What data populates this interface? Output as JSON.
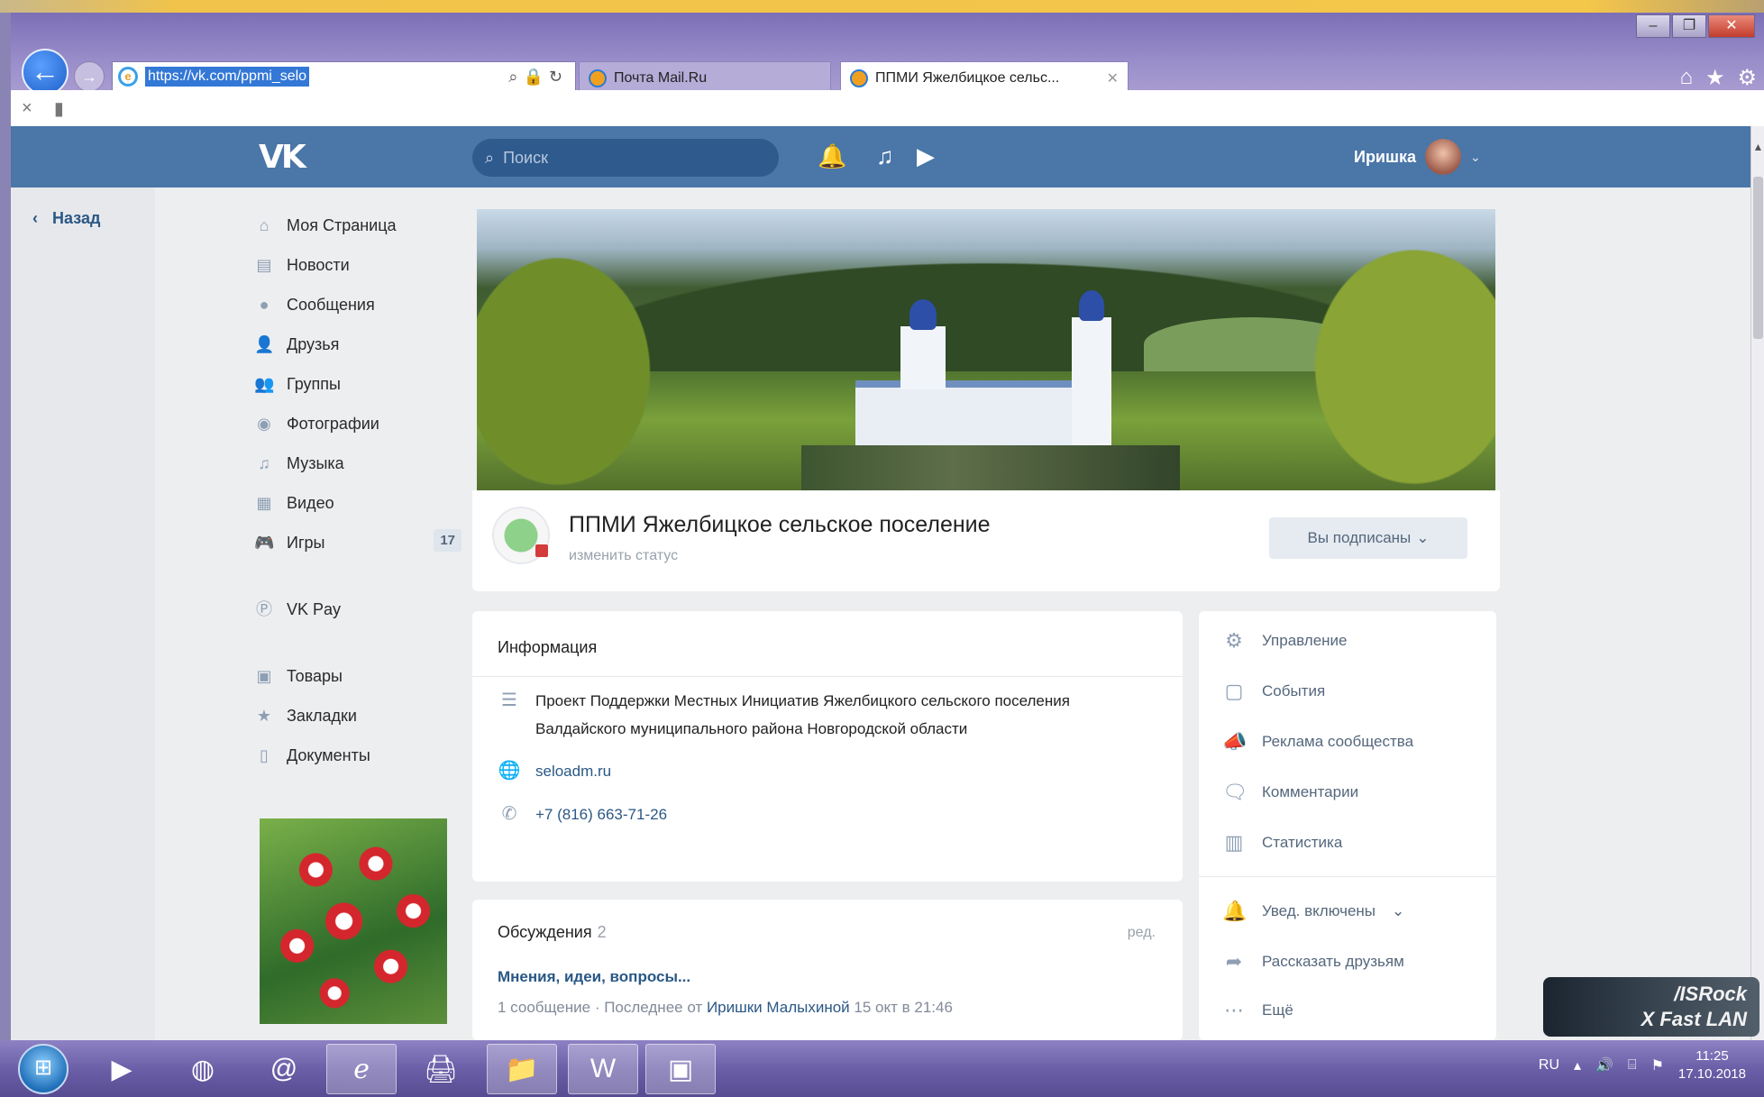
{
  "browser": {
    "url": "https://vk.com/ppmi_selo",
    "tabs": [
      {
        "label": "Почта Mail.Ru"
      },
      {
        "label": "ППМИ Яжелбицкое сельс..."
      }
    ]
  },
  "vk": {
    "logo": "VK",
    "search_placeholder": "Поиск",
    "user_name": "Иришка"
  },
  "back": {
    "label": "Назад"
  },
  "menu": {
    "items": [
      {
        "label": "Моя Страница",
        "icon": "home-icon"
      },
      {
        "label": "Новости",
        "icon": "news-icon"
      },
      {
        "label": "Сообщения",
        "icon": "messages-icon"
      },
      {
        "label": "Друзья",
        "icon": "friend-icon"
      },
      {
        "label": "Группы",
        "icon": "groups-icon"
      },
      {
        "label": "Фотографии",
        "icon": "camera-icon"
      },
      {
        "label": "Музыка",
        "icon": "music-icon"
      },
      {
        "label": "Видео",
        "icon": "video-icon"
      },
      {
        "label": "Игры",
        "icon": "gamepad-icon",
        "count": "17"
      }
    ],
    "items2": [
      {
        "label": "VK Pay",
        "icon": "vkpay-icon"
      }
    ],
    "items3": [
      {
        "label": "Товары",
        "icon": "bag-icon"
      },
      {
        "label": "Закладки",
        "icon": "star-icon"
      },
      {
        "label": "Документы",
        "icon": "document-icon"
      }
    ]
  },
  "group": {
    "title": "ППМИ Яжелбицкое сельское поселение",
    "status": "изменить статус",
    "subscribe_button": "Вы подписаны"
  },
  "info": {
    "heading": "Информация",
    "description": "Проект Поддержки Местных Инициатив Яжелбицкого сельского поселения",
    "description2": "Валдайского муниципального района Новгородской области",
    "website": "seloadm.ru",
    "phone": "+7 (816) 663-71-26"
  },
  "discussions": {
    "heading": "Обсуждения",
    "count": "2",
    "edit": "ред.",
    "topic": "Мнения, идеи, вопросы...",
    "meta_prefix": "1 сообщение · Последнее от",
    "meta_author": "Иришки Малыхиной",
    "meta_time": "15 окт в 21:46"
  },
  "actions": {
    "items": [
      {
        "label": "Управление",
        "icon": "gear-icon"
      },
      {
        "label": "События",
        "icon": "events-icon"
      },
      {
        "label": "Реклама сообщества",
        "icon": "megaphone-icon"
      },
      {
        "label": "Комментарии",
        "icon": "comment-icon"
      },
      {
        "label": "Статистика",
        "icon": "stats-icon"
      }
    ],
    "notifications": "Увед. включены",
    "share": "Рассказать друзьям",
    "more": "Ещё"
  },
  "badge": {
    "line1": "/ISRock",
    "line2": "X Fast LAN"
  },
  "taskbar": {
    "lang": "RU",
    "time": "11:25",
    "date": "17.10.2018"
  }
}
